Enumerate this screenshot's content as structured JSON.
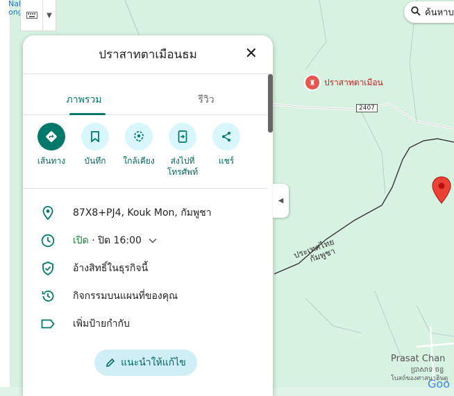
{
  "map": {
    "corner_text": [
      "Nak",
      "ong"
    ],
    "poi_name": "ปราสาทตาเมือน",
    "road_number": "2407",
    "border_label_line1": "ประเทศไทย",
    "border_label_line2": "กัมพูชา",
    "place_name": "Prasat Chan",
    "place_name_local": "ប្រាសាទ ចន្ទ",
    "place_subtext": "โบสถ์ของศาสนาฮินดู",
    "google_text": "Goo"
  },
  "search": {
    "label": "ค้นหาบ"
  },
  "panel": {
    "title": "ปราสาทตาเมือนธม",
    "tabs": [
      {
        "label": "ภาพรวม",
        "active": true
      },
      {
        "label": "รีวิว",
        "active": false
      }
    ],
    "actions": [
      {
        "label": "เส้นทาง",
        "icon": "directions-icon"
      },
      {
        "label": "บันทึก",
        "icon": "bookmark-icon"
      },
      {
        "label": "ใกล้เคียง",
        "icon": "nearby-icon"
      },
      {
        "label": "ส่งไปที่\nโทรศัพท์",
        "icon": "send-to-phone-icon"
      },
      {
        "label": "แชร์",
        "icon": "share-icon"
      }
    ],
    "rows": {
      "address": "87X8+PJ4, Kouk Mon, กัมพูชา",
      "hours_open": "เปิด",
      "hours_rest": " · ปิด 16:00",
      "claim": "อ้างสิทธิ์ในธุรกิจนี้",
      "activity": "กิจกรรมบนแผนที่ของคุณ",
      "label": "เพิ่มป้ายกำกับ"
    },
    "suggest_label": "แนะนำให้แก้ไข"
  },
  "colors": {
    "accent": "#00796b",
    "accent_light": "#d8f6fb",
    "map_bg": "#d7f2e1",
    "pin": "#e8554e"
  }
}
